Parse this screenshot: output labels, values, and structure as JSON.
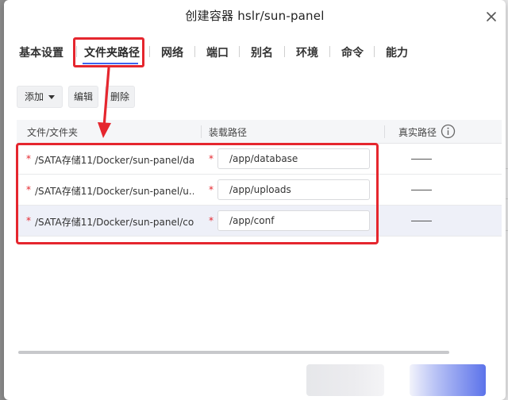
{
  "background": {
    "left_chars": [
      "",
      "",
      "",
      "",
      ""
    ]
  },
  "dialog": {
    "title": "创建容器 hslr/sun-panel"
  },
  "tabs": [
    {
      "label": "基本设置",
      "active": false
    },
    {
      "label": "文件夹路径",
      "active": true
    },
    {
      "label": "网络",
      "active": false
    },
    {
      "label": "端口",
      "active": false
    },
    {
      "label": "别名",
      "active": false
    },
    {
      "label": "环境",
      "active": false
    },
    {
      "label": "命令",
      "active": false
    },
    {
      "label": "能力",
      "active": false
    }
  ],
  "toolbar": {
    "add_label": "添加",
    "edit_label": "编辑",
    "delete_label": "删除"
  },
  "table": {
    "columns": [
      "文件/文件夹",
      "装载路径",
      "真实路径"
    ],
    "rows": [
      {
        "required": "*",
        "source": "/SATA存储11/Docker/sun-panel/da...",
        "mount_required": "*",
        "mount": "/app/database",
        "real": "——"
      },
      {
        "required": "*",
        "source": "/SATA存储11/Docker/sun-panel/u...",
        "mount_required": "*",
        "mount": "/app/uploads",
        "real": "——"
      },
      {
        "required": "*",
        "source": "/SATA存储11/Docker/sun-panel/co...",
        "mount_required": "*",
        "mount": "/app/conf",
        "real": "——"
      }
    ]
  },
  "colors": {
    "accent": "#3d63f0",
    "annotation": "#e5262e",
    "required": "#e5262e"
  },
  "icons": {
    "close": "close-icon",
    "info": "info-icon",
    "dropdown": "caret-down-icon"
  }
}
